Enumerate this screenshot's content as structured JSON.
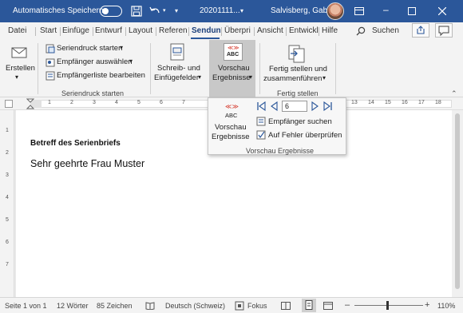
{
  "title_bar": {
    "autosave_label": "Automatisches Speichern",
    "autosave_state": "off",
    "document_name": "20201111...",
    "user_name": "Salvisberg, Gaby",
    "color": "#2b579a"
  },
  "tabs": [
    {
      "label": "Datei"
    },
    {
      "label": "Start"
    },
    {
      "label": "Einfüge"
    },
    {
      "label": "Entwurf"
    },
    {
      "label": "Layout"
    },
    {
      "label": "Referen"
    },
    {
      "label": "Sendun"
    },
    {
      "label": "Überpri"
    },
    {
      "label": "Ansicht"
    },
    {
      "label": "Entwickl"
    },
    {
      "label": "Hilfe"
    }
  ],
  "selected_tab": "Sendun",
  "search_label": "Suchen",
  "ribbon": {
    "erstellen": "Erstellen",
    "seriendruck_starten": "Seriendruck starten",
    "empfaenger_auswaehlen": "Empfänger auswählen",
    "empfaengerliste_bearbeiten": "Empfängerliste bearbeiten",
    "group_seriendruck": "Seriendruck starten",
    "schreib_line1": "Schreib- und",
    "schreib_line2": "Einfügefelder",
    "vorschau_line1": "Vorschau",
    "vorschau_line2": "Ergebnisse",
    "vorschau_icon_text": "ABC",
    "fertig_line1": "Fertig stellen und",
    "fertig_line2": "zusammenführen",
    "group_fertig": "Fertig stellen"
  },
  "panel": {
    "vorschau_line1": "Vorschau",
    "vorschau_line2": "Ergebnisse",
    "icon_text": "ABC",
    "record_number": "6",
    "empfaenger_suchen": "Empfänger suchen",
    "fehler_ueberpruefen": "Auf Fehler überprüfen",
    "group_label": "Vorschau Ergebnisse"
  },
  "ruler": {
    "left_marks": [
      "1",
      "2",
      "3",
      "4",
      "5",
      "6",
      "7"
    ],
    "right_marks": [
      "13",
      "14",
      "15",
      "16",
      "17",
      "18"
    ]
  },
  "vruler_marks": [
    "1",
    "2",
    "3",
    "4",
    "5",
    "6",
    "7"
  ],
  "document": {
    "subject": "Betreff des Serienbriefs",
    "salutation": "Sehr geehrte Frau Muster"
  },
  "status": {
    "page": "Seite 1 von 1",
    "words": "12 Wörter",
    "chars": "85 Zeichen",
    "language": "Deutsch (Schweiz)",
    "focus": "Fokus",
    "zoom": "110%"
  }
}
